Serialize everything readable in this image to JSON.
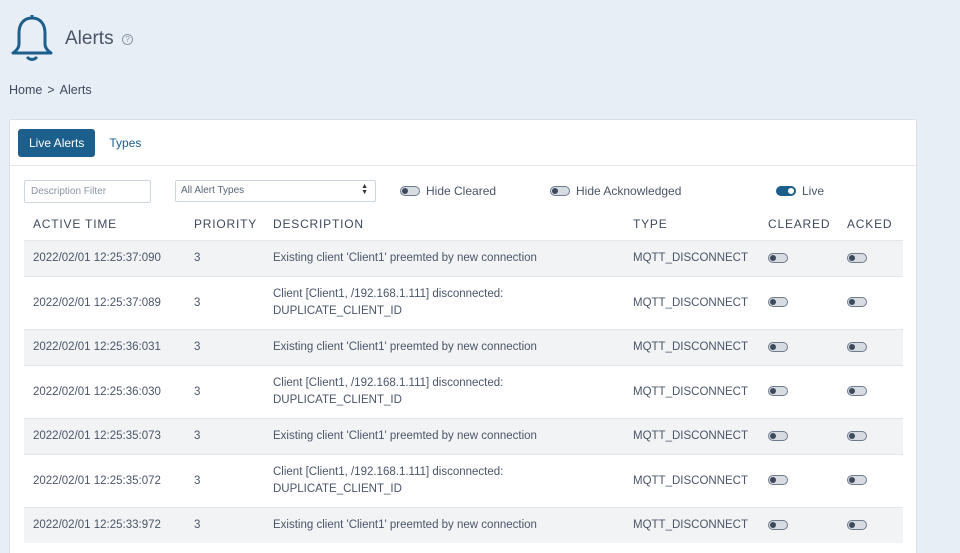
{
  "header": {
    "title": "Alerts",
    "help_glyph": "?"
  },
  "breadcrumb": {
    "home": "Home",
    "separator": ">",
    "current": "Alerts"
  },
  "tabs": [
    {
      "label": "Live Alerts"
    },
    {
      "label": "Types"
    }
  ],
  "filters": {
    "description_placeholder": "Description Filter",
    "type_select": "All Alert Types",
    "hide_cleared": {
      "label": "Hide Cleared",
      "on": false
    },
    "hide_acknowledged": {
      "label": "Hide Acknowledged",
      "on": false
    },
    "live": {
      "label": "Live",
      "on": true
    }
  },
  "table": {
    "columns": [
      "ACTIVE TIME",
      "PRIORITY",
      "DESCRIPTION",
      "TYPE",
      "CLEARED",
      "ACKED"
    ],
    "rows": [
      {
        "time": "2022/02/01 12:25:37:090",
        "priority": "3",
        "desc1": "Existing client 'Client1' preemted by new connection",
        "desc2": "",
        "type": "MQTT_DISCONNECT"
      },
      {
        "time": "2022/02/01 12:25:37:089",
        "priority": "3",
        "desc1": "Client [Client1, /192.168.1.111] disconnected:",
        "desc2": "DUPLICATE_CLIENT_ID",
        "type": "MQTT_DISCONNECT"
      },
      {
        "time": "2022/02/01 12:25:36:031",
        "priority": "3",
        "desc1": "Existing client 'Client1' preemted by new connection",
        "desc2": "",
        "type": "MQTT_DISCONNECT"
      },
      {
        "time": "2022/02/01 12:25:36:030",
        "priority": "3",
        "desc1": "Client [Client1, /192.168.1.111] disconnected:",
        "desc2": "DUPLICATE_CLIENT_ID",
        "type": "MQTT_DISCONNECT"
      },
      {
        "time": "2022/02/01 12:25:35:073",
        "priority": "3",
        "desc1": "Existing client 'Client1' preemted by new connection",
        "desc2": "",
        "type": "MQTT_DISCONNECT"
      },
      {
        "time": "2022/02/01 12:25:35:072",
        "priority": "3",
        "desc1": "Client [Client1, /192.168.1.111] disconnected:",
        "desc2": "DUPLICATE_CLIENT_ID",
        "type": "MQTT_DISCONNECT"
      },
      {
        "time": "2022/02/01 12:25:33:972",
        "priority": "3",
        "desc1": "Existing client 'Client1' preemted by new connection",
        "desc2": "",
        "type": "MQTT_DISCONNECT"
      }
    ]
  },
  "colors": {
    "accent": "#1c5f8c",
    "background": "#e8eef5"
  }
}
